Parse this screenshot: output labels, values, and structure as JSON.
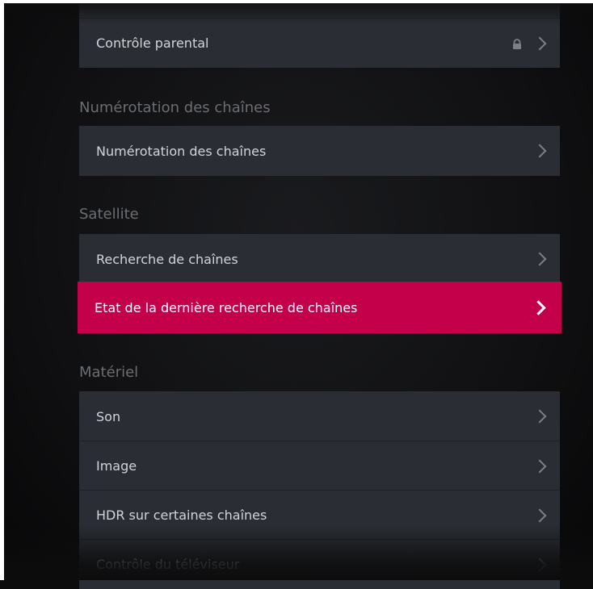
{
  "menu": {
    "top_item": {
      "label": "Contrôle parental",
      "locked": true
    },
    "sections": [
      {
        "title": "Numérotation des chaînes",
        "items": [
          "Numérotation des chaînes"
        ]
      },
      {
        "title": "Satellite",
        "items": [
          "Recherche de chaînes",
          "Etat de la dernière recherche de chaînes"
        ]
      },
      {
        "title": "Matériel",
        "items": [
          "Son",
          "Image",
          "HDR sur certaines chaînes",
          "Contrôle du téléviseur"
        ]
      }
    ],
    "selected_item": "Etat de la dernière recherche de chaînes"
  },
  "colors": {
    "background": "#0c0c0d",
    "row": "#2a2e34",
    "accent": "#c4004b",
    "section_text": "#6a6d72",
    "row_text": "#d2d4d8"
  },
  "icons": {
    "lock": "lock-icon",
    "chevron": "chevron-right-icon"
  }
}
